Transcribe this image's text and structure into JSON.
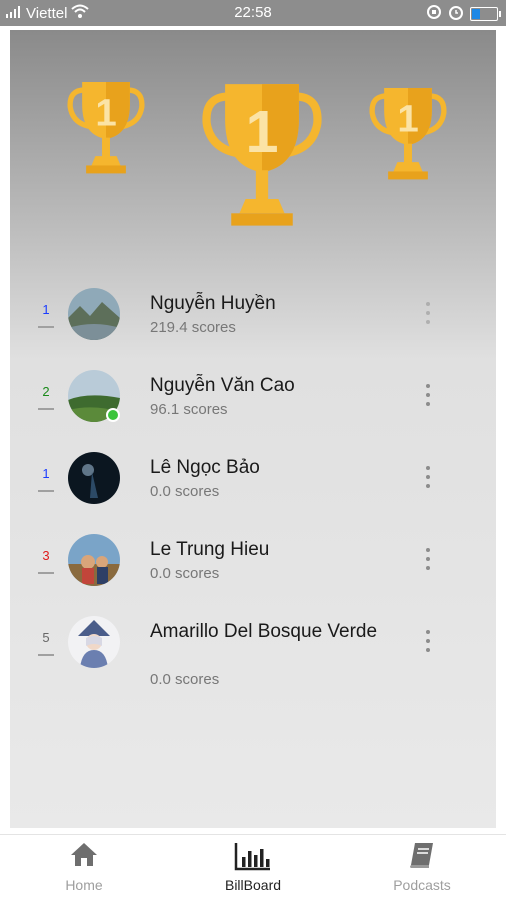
{
  "status_bar": {
    "carrier": "Viettel",
    "time": "22:58",
    "icons": [
      "signal-icon",
      "wifi-icon",
      "rotation-lock-icon",
      "alarm-icon",
      "battery-icon"
    ]
  },
  "podium": {
    "trophy_icon": "trophy-icon",
    "trophy_colors": {
      "cup": "#f5b62e",
      "shade": "#e8a21c",
      "number": "#fbe3a6"
    },
    "places": [
      {
        "position": "left",
        "number": "1"
      },
      {
        "position": "center",
        "number": "1"
      },
      {
        "position": "right",
        "number": "1"
      }
    ]
  },
  "leaderboard": [
    {
      "rank": "1",
      "rank_color": "#1a3cff",
      "name": "Nguyễn Huyền",
      "score": "219.4 scores",
      "online": false,
      "avatar_icon": "landscape-avatar"
    },
    {
      "rank": "2",
      "rank_color": "#1a8a1a",
      "name": "Nguyễn Văn Cao",
      "score": "96.1 scores",
      "online": true,
      "avatar_icon": "landscape-avatar"
    },
    {
      "rank": "1",
      "rank_color": "#1a3cff",
      "name": "Lê Ngọc Bảo",
      "score": "0.0 scores",
      "online": false,
      "avatar_icon": "night-avatar"
    },
    {
      "rank": "3",
      "rank_color": "#e01a1a",
      "name": "Le Trung Hieu",
      "score": "0.0 scores",
      "online": false,
      "avatar_icon": "photo-avatar"
    },
    {
      "rank": "5",
      "rank_color": "#666666",
      "name": "Amarillo Del Bosque Verde",
      "score": "0.0 scores",
      "online": false,
      "avatar_icon": "character-avatar"
    }
  ],
  "bottom_nav": [
    {
      "label": "Home",
      "icon": "home-icon",
      "active": false
    },
    {
      "label": "BillBoard",
      "icon": "bar-chart-icon",
      "active": true
    },
    {
      "label": "Podcasts",
      "icon": "book-icon",
      "active": false
    }
  ]
}
